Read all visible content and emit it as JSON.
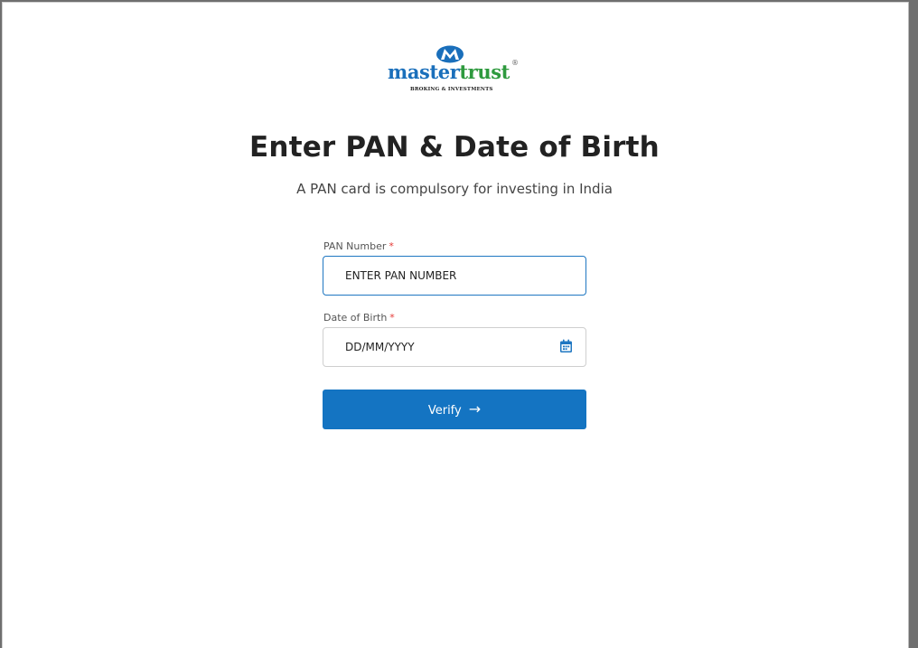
{
  "logo": {
    "word_part1": "master",
    "word_part2": "trust",
    "registered": "®",
    "tagline": "BROKING & INVESTMENTS",
    "colors": {
      "primary": "#1a6fbb",
      "secondary": "#2e9a3e"
    }
  },
  "page": {
    "title": "Enter PAN & Date of Birth",
    "subtitle": "A PAN card is compulsory for investing in India"
  },
  "form": {
    "pan": {
      "label": "PAN Number",
      "required_mark": "*",
      "value": "ENTER PAN NUMBER"
    },
    "dob": {
      "label": "Date of Birth",
      "required_mark": "*",
      "value": "DD/MM/YYYY",
      "icon": "calendar-icon"
    },
    "verify": {
      "label": "Verify",
      "arrow": "→",
      "color": "#1474c2"
    }
  }
}
